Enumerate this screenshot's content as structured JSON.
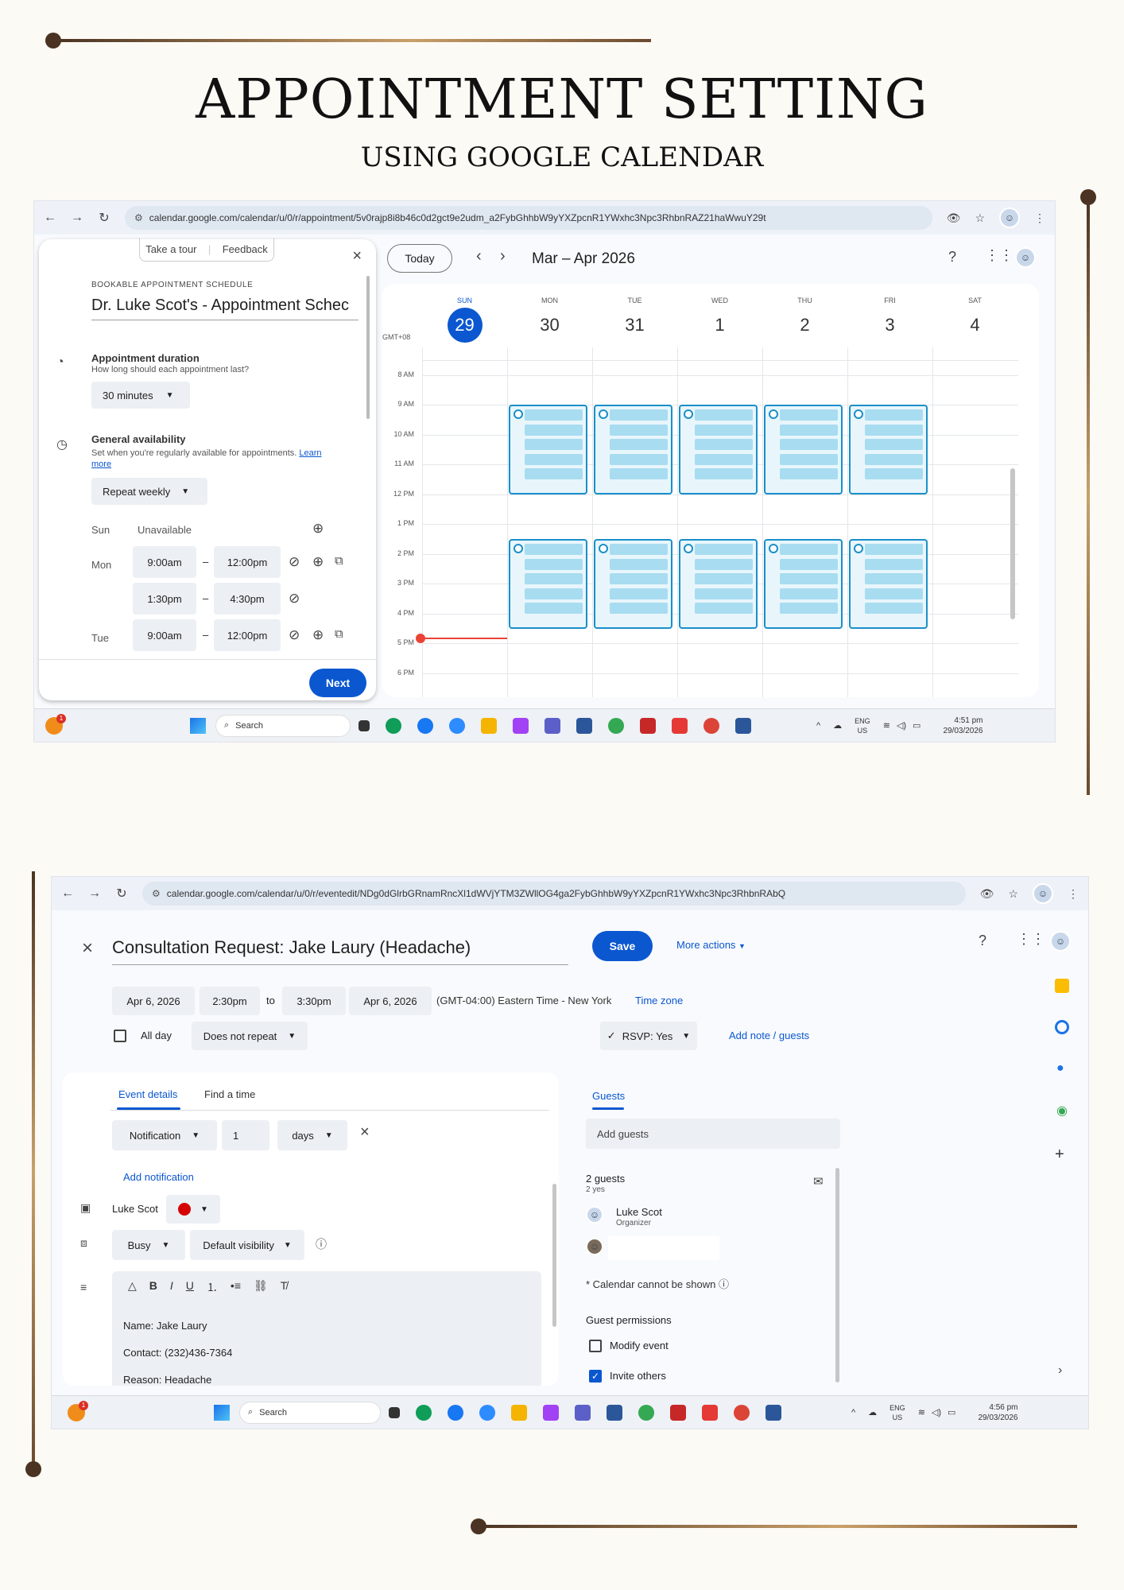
{
  "header": {
    "title": "APPOINTMENT SETTING",
    "subtitle": "USING GOOGLE CALENDAR"
  },
  "shot1": {
    "url": "calendar.google.com/calendar/u/0/r/appointment/5v0rajp8i8b46c0d2gct9e2udm_a2FybGhhbW9yYXZpcnR1YWxhc3Npc3RhbnRAZ21haWwuY29t",
    "panel": {
      "take_tour": "Take a tour",
      "feedback": "Feedback",
      "section_label": "BOOKABLE APPOINTMENT SCHEDULE",
      "schedule_name": "Dr. Luke Scot's - Appointment Schec",
      "duration_title": "Appointment duration",
      "duration_help": "How long should each appointment last?",
      "duration_value": "30 minutes",
      "availability_title": "General availability",
      "availability_help": "Set when you're regularly available for appointments.",
      "learn": "Learn",
      "more": "more",
      "repeat_value": "Repeat weekly",
      "sun": "Sun",
      "unavailable": "Unavailable",
      "mon": "Mon",
      "tue": "Tue",
      "dash": "–",
      "mon1_start": "9:00am",
      "mon1_end": "12:00pm",
      "mon2_start": "1:30pm",
      "mon2_end": "4:30pm",
      "tue1_start": "9:00am",
      "tue1_end": "12:00pm",
      "next": "Next"
    },
    "cal": {
      "today": "Today",
      "range": "Mar – Apr 2026",
      "tz": "GMT+08",
      "days": [
        {
          "dow": "SUN",
          "num": "29"
        },
        {
          "dow": "MON",
          "num": "30"
        },
        {
          "dow": "TUE",
          "num": "31"
        },
        {
          "dow": "WED",
          "num": "1"
        },
        {
          "dow": "THU",
          "num": "2"
        },
        {
          "dow": "FRI",
          "num": "3"
        },
        {
          "dow": "SAT",
          "num": "4"
        }
      ],
      "hours": [
        "8 AM",
        "9 AM",
        "10 AM",
        "11 AM",
        "12 PM",
        "1 PM",
        "2 PM",
        "3 PM",
        "4 PM",
        "5 PM",
        "6 PM"
      ]
    },
    "taskbar": {
      "search": "Search",
      "lang1": "ENG",
      "lang2": "US",
      "time": "4:51 pm",
      "date": "29/03/2026",
      "badge": "1"
    }
  },
  "shot2": {
    "url": "calendar.google.com/calendar/u/0/r/eventedit/NDg0dGlrbGRnamRncXl1dWVjYTM3ZWllOG4ga2FybGhhbW9yYXZpcnR1YWxhc3Npc3RhbnRAbQ",
    "event_title": "Consultation Request: Jake Laury (Headache)",
    "save": "Save",
    "more_actions": "More actions",
    "start_date": "Apr 6, 2026",
    "start_time": "2:30pm",
    "to": "to",
    "end_time": "3:30pm",
    "end_date": "Apr 6, 2026",
    "timezone": "(GMT-04:00) Eastern Time - New York",
    "timezone_link": "Time zone",
    "all_day": "All day",
    "repeat": "Does not repeat",
    "rsvp": "RSVP: Yes",
    "add_note": "Add note / guests",
    "tab_details": "Event details",
    "tab_find": "Find a time",
    "notif_type": "Notification",
    "notif_num": "1",
    "notif_unit": "days",
    "add_notification": "Add notification",
    "calendar_owner": "Luke Scot",
    "busy": "Busy",
    "visibility": "Default visibility",
    "desc_lines": [
      "Name: Jake Laury",
      "Contact:  (232)436-7364",
      "Reason: Headache"
    ],
    "guests_tab": "Guests",
    "add_guests": "Add guests",
    "guest_count": "2 guests",
    "guest_yes": "2 yes",
    "organizer_name": "Luke Scot",
    "organizer_role": "Organizer",
    "calendar_note": "* Calendar cannot be shown",
    "perm_title": "Guest permissions",
    "perm_modify": "Modify event",
    "perm_invite": "Invite others",
    "taskbar": {
      "search": "Search",
      "lang1": "ENG",
      "lang2": "US",
      "time": "4:56 pm",
      "date": "29/03/2026",
      "badge": "1"
    }
  },
  "colors": {
    "accent": "#0b57d0",
    "slot_border": "#1a8fc9",
    "slot_fill": "#a8dcf0",
    "event_color": "#d50000",
    "frame": "#4a3322"
  }
}
